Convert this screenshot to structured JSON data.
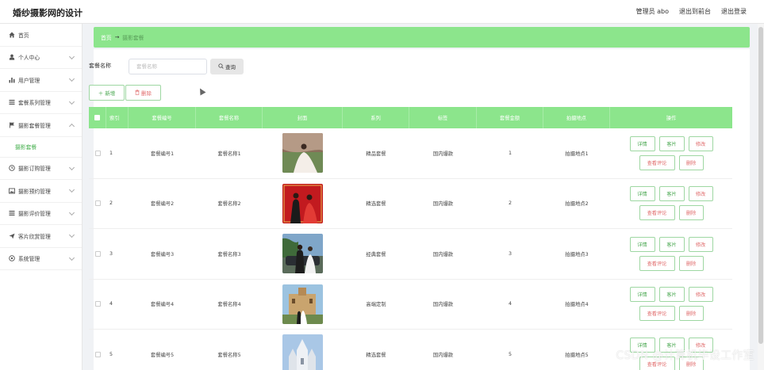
{
  "header": {
    "title": "婚纱摄影网的设计",
    "admin_label": "管理员 abo",
    "front_link": "退出到前台",
    "logout_link": "退出登录"
  },
  "sidebar": {
    "items": [
      {
        "label": "首页",
        "icon": "home-icon"
      },
      {
        "label": "个人中心",
        "icon": "user-icon"
      },
      {
        "label": "用户管理",
        "icon": "bar-chart-icon"
      },
      {
        "label": "套餐系列管理",
        "icon": "list-icon"
      },
      {
        "label": "摄影套餐管理",
        "icon": "flag-icon"
      },
      {
        "label": "摄影套餐",
        "icon": ""
      },
      {
        "label": "摄影订购管理",
        "icon": "clock-icon"
      },
      {
        "label": "摄影预约管理",
        "icon": "image-icon"
      },
      {
        "label": "摄影评价管理",
        "icon": "list-icon"
      },
      {
        "label": "客片欣赏管理",
        "icon": "send-icon"
      },
      {
        "label": "系统管理",
        "icon": "settings-icon"
      }
    ]
  },
  "breadcrumb": {
    "home": "首页",
    "separator": "→",
    "current": "摄影套餐"
  },
  "search": {
    "label": "套餐名称",
    "placeholder": "套餐名称",
    "button_label": "查询"
  },
  "toolbar": {
    "add_label": "新增",
    "delete_label": "删除"
  },
  "table": {
    "headers": [
      "索引",
      "套餐编号",
      "套餐名称",
      "封面",
      "系列",
      "标签",
      "套餐金额",
      "拍摄地点",
      "操作"
    ],
    "ops": {
      "detail": "详情",
      "sample": "客片",
      "edit": "修改",
      "reviews": "查看评论",
      "delete": "删除"
    },
    "rows": [
      {
        "index": "1",
        "no": "套餐编号1",
        "name": "套餐名称1",
        "series": "精品套餐",
        "tag": "国内爆款",
        "amount": "1",
        "location": "拍摄地点1"
      },
      {
        "index": "2",
        "no": "套餐编号2",
        "name": "套餐名称2",
        "series": "精选套餐",
        "tag": "国内爆款",
        "amount": "2",
        "location": "拍摄地点2"
      },
      {
        "index": "3",
        "no": "套餐编号3",
        "name": "套餐名称3",
        "series": "经典套餐",
        "tag": "国内爆款",
        "amount": "3",
        "location": "拍摄地点3"
      },
      {
        "index": "4",
        "no": "套餐编号4",
        "name": "套餐名称4",
        "series": "高端定制",
        "tag": "国内爆款",
        "amount": "4",
        "location": "拍摄地点4"
      },
      {
        "index": "5",
        "no": "套餐编号5",
        "name": "套餐名称5",
        "series": "精选套餐",
        "tag": "国内爆款",
        "amount": "5",
        "location": "拍摄地点5"
      }
    ]
  },
  "watermark": "CSDN @计算机毕设工作室",
  "colors": {
    "accent": "#8ce58c",
    "green_text": "#4aa851",
    "red_text": "#e06b6b"
  }
}
